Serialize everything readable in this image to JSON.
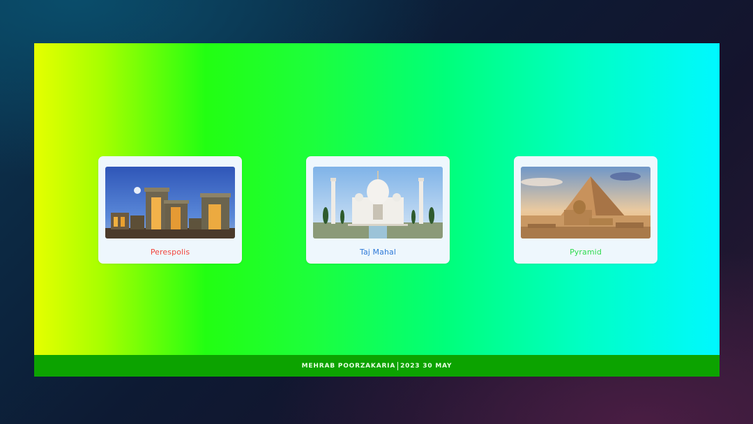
{
  "cards": [
    {
      "caption": "Perespolis",
      "caption_color": "#f2453d"
    },
    {
      "caption": "Taj Mahal",
      "caption_color": "#2f7ad8"
    },
    {
      "caption": "Pyramid",
      "caption_color": "#2fdb4e"
    }
  ],
  "footer": {
    "author": "MEHRAB POORZAKARIA",
    "date": "2023 30 MAY"
  },
  "colors": {
    "footer_bg": "#0ca300",
    "card_bg": "#eef7fd"
  }
}
